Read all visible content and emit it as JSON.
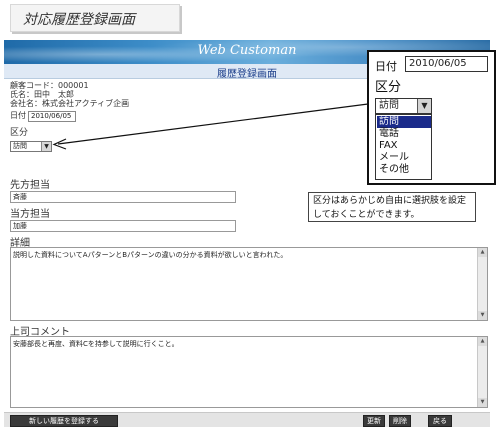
{
  "page_title": "対応履歴登録画面",
  "app": {
    "brand": "Web Customan",
    "screen_title": "履歴登録画面"
  },
  "customer": {
    "code_line": "顧客コード：000001",
    "name_line": "氏名：田中　太郎",
    "company_line": "会社名：株式会社アクティブ企画",
    "date_label": "日付",
    "date_value": "2010/06/05",
    "kubun_label": "区分",
    "kubun_value": "訪問"
  },
  "fields": {
    "sakihou_label": "先方担当",
    "sakihou_value": "斉藤",
    "touhou_label": "当方担当",
    "touhou_value": "加藤",
    "detail_label": "詳細",
    "detail_value": "説明した資料についてAパターンとBパターンの違いの分かる資料が欲しいと言われた。",
    "boss_label": "上司コメント",
    "boss_value": "安藤部長と再度、資料Cを持参して説明に行くこと。"
  },
  "callout": {
    "date_label": "日付",
    "date_value": "2010/06/05",
    "kubun_label": "区分",
    "selected": "訪問",
    "options": [
      "訪問",
      "電話",
      "FAX",
      "メール",
      "その他"
    ]
  },
  "note": "区分はあらかじめ自由に選択肢を設定しておくことができます。",
  "footer": {
    "new_button": "新しい履歴を登録する",
    "update_button": "更新",
    "delete_button": "削除",
    "back_button": "戻る"
  }
}
